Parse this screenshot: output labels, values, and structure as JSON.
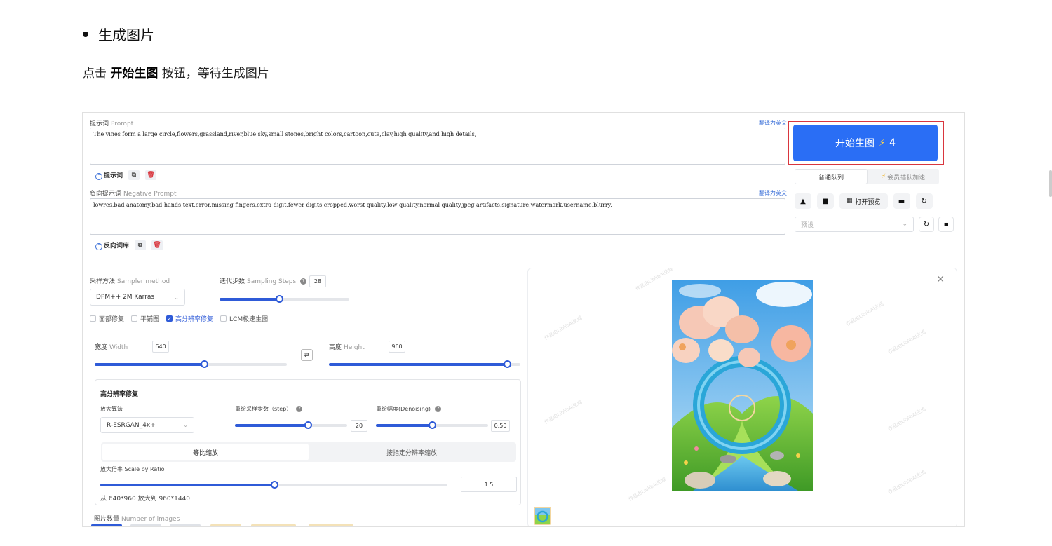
{
  "doc": {
    "bullet": "生成图片",
    "para_pre": "点击 ",
    "para_bold": "开始生图",
    "para_post": " 按钮，等待生成图片"
  },
  "prompt": {
    "label_cn": "提示词",
    "label_en": "Prompt",
    "translate": "翻译为英文",
    "value": "The vines form a large circle,flowers,grassland,river,blue sky,small stones,bright colors,cartoon,cute,clay,high quality,and high details,",
    "tag_label": "提示词"
  },
  "negative": {
    "label_cn": "负向提示词",
    "label_en": "Negative Prompt",
    "translate": "翻译为英文",
    "value": "lowres,bad anatomy,bad hands,text,error,missing fingers,extra digit,fewer digits,cropped,worst quality,low quality,normal quality,jpeg artifacts,signature,watermark,username,blurry,",
    "tag_label": "反向词库"
  },
  "generate": {
    "label": "开始生图",
    "bolt": "⚡",
    "cost": "4",
    "queue_normal": "普通队列",
    "queue_vip": "会员插队加速",
    "preview_label": "打开预览",
    "preset_placeholder": "预设"
  },
  "sampler": {
    "label_cn": "采样方法",
    "label_en": "Sampler method",
    "value": "DPM++ 2M Karras",
    "steps_cn": "迭代步数",
    "steps_en": "Sampling Steps",
    "steps_value": "28",
    "steps_fraction": 0.46
  },
  "options": {
    "face_fix": "面部修复",
    "tiling": "平铺图",
    "hires_fix": "高分辨率修复",
    "lcm": "LCM极速生图"
  },
  "size": {
    "width_cn": "宽度",
    "width_en": "Width",
    "width_value": "640",
    "width_fraction": 0.57,
    "height_cn": "高度",
    "height_en": "Height",
    "height_value": "960",
    "height_fraction": 0.93
  },
  "hires": {
    "title": "高分辨率修复",
    "upscaler_label": "放大算法",
    "upscaler_value": "R-ESRGAN_4x+",
    "steps_label": "重绘采样步数（step）",
    "steps_value": "20",
    "steps_fraction": 0.65,
    "denoise_label": "重绘幅度(Denoising)",
    "denoise_value": "0.50",
    "denoise_fraction": 0.5,
    "mode_ratio": "等比缩放",
    "mode_resolution": "按指定分辨率缩放",
    "scale_label": "放大倍率 Scale by Ratio",
    "scale_value": "1.5",
    "scale_fraction": 0.5,
    "result": "从 640*960 放大到 960*1440"
  },
  "num_images": {
    "label_cn": "图片数量",
    "label_en": "Number of images"
  },
  "colors": {
    "accent": "#2a6ef5",
    "highlight": "#d9363e",
    "slider": "#2f5bd8"
  }
}
